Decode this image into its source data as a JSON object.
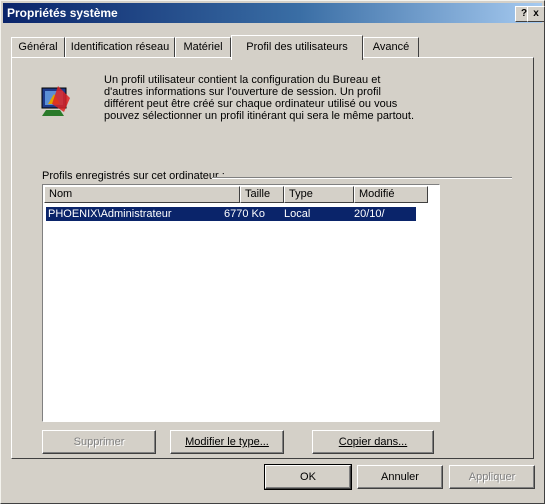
{
  "window": {
    "title": "Propriétés système",
    "help_button": "?",
    "close_button": "x"
  },
  "tabs": [
    {
      "label": "Général"
    },
    {
      "label": "Identification réseau"
    },
    {
      "label": "Matériel"
    },
    {
      "label": "Profil des utilisateurs"
    },
    {
      "label": "Avancé"
    }
  ],
  "info_text": "Un profil utilisateur contient la configuration du Bureau et d'autres informations sur l'ouverture de session. Un profil différent peut être créé sur chaque ordinateur utilisé ou vous pouvez sélectionner un profil itinérant qui sera le même partout.",
  "group_label": "Profils enregistrés sur cet ordinateur :",
  "list": {
    "columns": [
      "Nom",
      "Taille",
      "Type",
      "Modifié"
    ],
    "rows": [
      {
        "name": "PHOENIX\\Administrateur",
        "size": "6770 Ko",
        "type": "Local",
        "modified": "20/10/"
      }
    ]
  },
  "buttons": {
    "delete": "Supprimer",
    "change_type": "Modifier le type...",
    "copy_to": "Copier dans..."
  },
  "dialog_buttons": {
    "ok": "OK",
    "cancel": "Annuler",
    "apply": "Appliquer"
  }
}
